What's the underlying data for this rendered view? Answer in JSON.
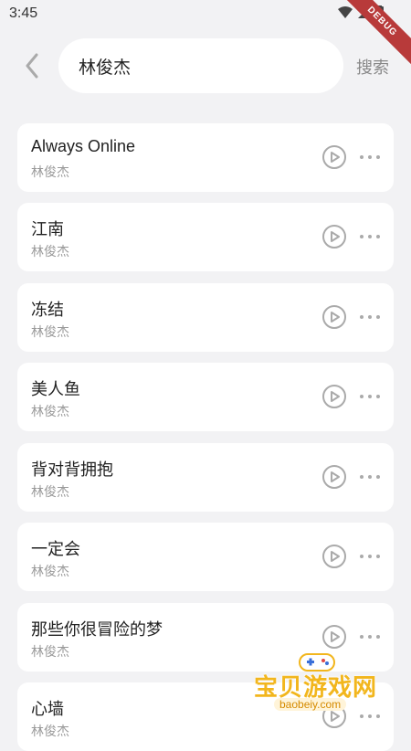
{
  "status_bar": {
    "time": "3:45",
    "debug_label": "DEBUG"
  },
  "search": {
    "query": "林俊杰",
    "action_label": "搜索"
  },
  "results": [
    {
      "title": "Always Online",
      "artist": "林俊杰"
    },
    {
      "title": "江南",
      "artist": "林俊杰"
    },
    {
      "title": "冻结",
      "artist": "林俊杰"
    },
    {
      "title": "美人鱼",
      "artist": "林俊杰"
    },
    {
      "title": "背对背拥抱",
      "artist": "林俊杰"
    },
    {
      "title": "一定会",
      "artist": "林俊杰"
    },
    {
      "title": "那些你很冒险的梦",
      "artist": "林俊杰"
    },
    {
      "title": "心墙",
      "artist": "林俊杰"
    }
  ],
  "watermark": {
    "name": "宝贝游戏网",
    "url": "baobeiy.com"
  },
  "colors": {
    "background": "#f2f2f4",
    "card": "#ffffff",
    "muted": "#999999",
    "watermark": "#f2b61d"
  },
  "icons": {
    "back": "chevron-left-icon",
    "play": "play-circle-icon",
    "more": "more-horizontal-icon"
  }
}
